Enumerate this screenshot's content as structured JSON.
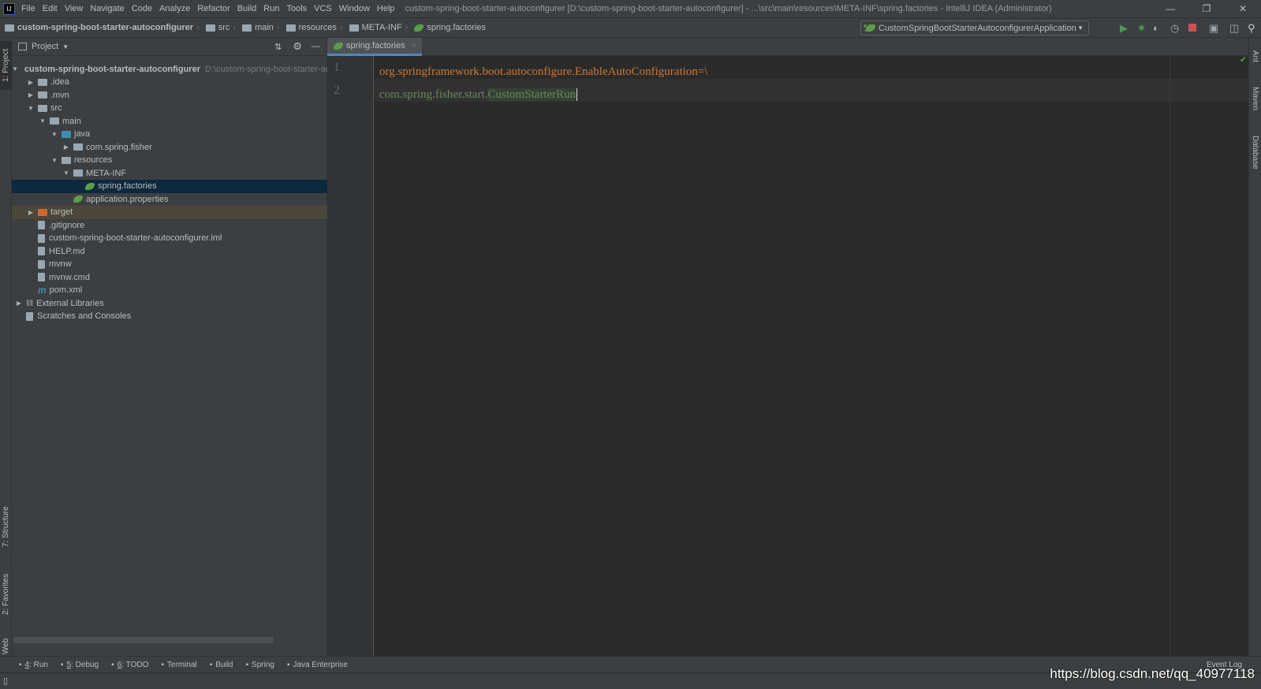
{
  "menubar": {
    "items": [
      "File",
      "Edit",
      "View",
      "Navigate",
      "Code",
      "Analyze",
      "Refactor",
      "Build",
      "Run",
      "Tools",
      "VCS",
      "Window",
      "Help"
    ],
    "title": "custom-spring-boot-starter-autoconfigurer [D:\\custom-spring-boot-starter-autoconfigurer] - ...\\src\\main\\resources\\META-INF\\spring.factories - IntelliJ IDEA (Administrator)"
  },
  "breadcrumb": [
    "custom-spring-boot-starter-autoconfigurer",
    "src",
    "main",
    "resources",
    "META-INF",
    "spring.factories"
  ],
  "toolbar": {
    "run_config": "CustomSpringBootStarterAutoconfigurerApplication"
  },
  "left_stripe": {
    "project": "1: Project",
    "structure": "7: Structure",
    "favorites": "2: Favorites",
    "web": "Web"
  },
  "right_stripe": {
    "ant": "Ant",
    "maven": "Maven",
    "database": "Database"
  },
  "project": {
    "header": "Project",
    "tree": [
      {
        "label": "custom-spring-boot-starter-autoconfigurer",
        "path": "D:\\custom-spring-boot-starter-autoconfigurer",
        "level": 0,
        "arrow": "open",
        "icon": "module"
      },
      {
        "label": ".idea",
        "level": 1,
        "arrow": "closed",
        "icon": "folder"
      },
      {
        "label": ".mvn",
        "level": 1,
        "arrow": "closed",
        "icon": "folder"
      },
      {
        "label": "src",
        "level": 1,
        "arrow": "open",
        "icon": "folder"
      },
      {
        "label": "main",
        "level": 2,
        "arrow": "open",
        "icon": "folder"
      },
      {
        "label": "java",
        "level": 3,
        "arrow": "open",
        "icon": "source-folder"
      },
      {
        "label": "com.spring.fisher",
        "level": 4,
        "arrow": "closed",
        "icon": "package"
      },
      {
        "label": "resources",
        "level": 3,
        "arrow": "open",
        "icon": "resources-folder"
      },
      {
        "label": "META-INF",
        "level": 4,
        "arrow": "open",
        "icon": "folder"
      },
      {
        "label": "spring.factories",
        "level": 5,
        "arrow": "none",
        "icon": "spring",
        "selected": true
      },
      {
        "label": "application.properties",
        "level": 4,
        "arrow": "none",
        "icon": "spring-config"
      },
      {
        "label": "target",
        "level": 1,
        "arrow": "closed",
        "icon": "excluded-folder",
        "highlight": true
      },
      {
        "label": ".gitignore",
        "level": 1,
        "arrow": "none",
        "icon": "file"
      },
      {
        "label": "custom-spring-boot-starter-autoconfigurer.iml",
        "level": 1,
        "arrow": "none",
        "icon": "file"
      },
      {
        "label": "HELP.md",
        "level": 1,
        "arrow": "none",
        "icon": "markdown"
      },
      {
        "label": "mvnw",
        "level": 1,
        "arrow": "none",
        "icon": "shell"
      },
      {
        "label": "mvnw.cmd",
        "level": 1,
        "arrow": "none",
        "icon": "file"
      },
      {
        "label": "pom.xml",
        "level": 1,
        "arrow": "none",
        "icon": "maven"
      },
      {
        "label": "External Libraries",
        "level": 0,
        "arrow": "closed",
        "icon": "libraries"
      },
      {
        "label": "Scratches and Consoles",
        "level": 0,
        "arrow": "none",
        "icon": "scratches"
      }
    ]
  },
  "editor": {
    "tab": "spring.factories",
    "lines": [
      {
        "num": "1",
        "parts": [
          {
            "t": "org.springframework.boot.autoconfigure.EnableAutoConfiguration=\\",
            "c": "#cc7832"
          }
        ]
      },
      {
        "num": "2",
        "parts": [
          {
            "t": "com.spring.fisher.start.",
            "c": "#6a8759"
          },
          {
            "t": "CustomStarterRun",
            "c": "#6a8759",
            "bg": "#344134"
          }
        ]
      }
    ]
  },
  "bottom_tools": [
    {
      "key": "4",
      "label": ": Run"
    },
    {
      "key": "5",
      "label": ": Debug"
    },
    {
      "key": "6",
      "label": ": TODO"
    },
    {
      "key": "",
      "label": "Terminal"
    },
    {
      "key": "",
      "label": "Build"
    },
    {
      "key": "",
      "label": "Spring"
    },
    {
      "key": "",
      "label": "Java Enterprise"
    }
  ],
  "event_log": "Event Log",
  "watermark": "https://blog.csdn.net/qq_40977118",
  "colors": {
    "keyword": "#cc7832",
    "string": "#6a8759",
    "selection": "#0d293e",
    "accent": "#4a88c7"
  }
}
